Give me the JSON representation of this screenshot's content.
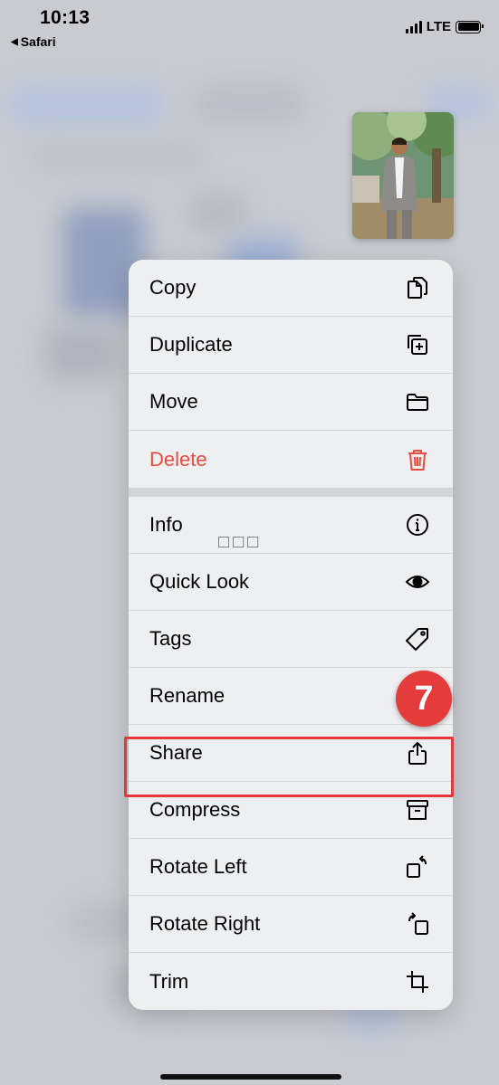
{
  "status_bar": {
    "time": "10:13",
    "back_app": "Safari",
    "network": "LTE"
  },
  "menu": {
    "group1": [
      {
        "label": "Copy",
        "icon": "copy-icon"
      },
      {
        "label": "Duplicate",
        "icon": "duplicate-icon"
      },
      {
        "label": "Move",
        "icon": "folder-icon"
      },
      {
        "label": "Delete",
        "icon": "trash-icon",
        "destructive": true
      }
    ],
    "group2": [
      {
        "label": "Info",
        "icon": "info-icon"
      },
      {
        "label": "Quick Look",
        "icon": "eye-icon"
      },
      {
        "label": "Tags",
        "icon": "tag-icon"
      },
      {
        "label": "Rename",
        "icon": "pencil-icon"
      },
      {
        "label": "Share",
        "icon": "share-icon"
      },
      {
        "label": "Compress",
        "icon": "archive-icon"
      },
      {
        "label": "Rotate Left",
        "icon": "rotate-left-icon"
      },
      {
        "label": "Rotate Right",
        "icon": "rotate-right-icon"
      },
      {
        "label": "Trim",
        "icon": "crop-icon"
      }
    ]
  },
  "annotations": {
    "step_number": "7",
    "garbled_text": "□□□"
  },
  "colors": {
    "destructive": "#eb4b3c",
    "highlight": "#e4393c",
    "badge": "#e63b3b"
  }
}
